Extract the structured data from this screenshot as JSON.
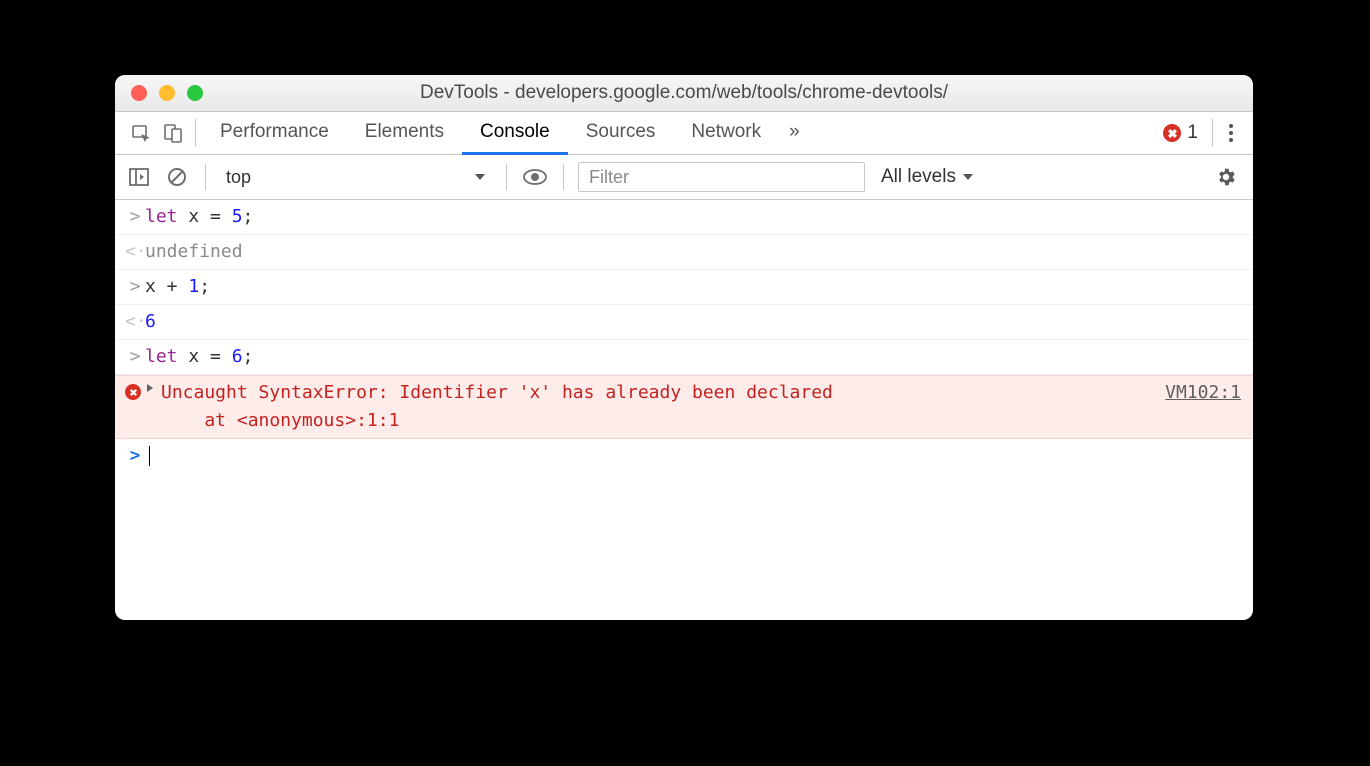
{
  "window": {
    "title": "DevTools - developers.google.com/web/tools/chrome-devtools/"
  },
  "tabs": {
    "items": [
      "Performance",
      "Elements",
      "Console",
      "Sources",
      "Network"
    ],
    "active": "Console",
    "overflow_glyph": "»",
    "error_count": "1"
  },
  "filterbar": {
    "context": "top",
    "filter_placeholder": "Filter",
    "levels_label": "All levels"
  },
  "console": {
    "rows": [
      {
        "kind": "input",
        "marker": ">",
        "tokens": [
          {
            "cls": "kw",
            "t": "let"
          },
          {
            "cls": "txt",
            "t": " x = "
          },
          {
            "cls": "num",
            "t": "5"
          },
          {
            "cls": "txt",
            "t": ";"
          }
        ]
      },
      {
        "kind": "output",
        "marker": "<·",
        "tokens": [
          {
            "cls": "undef",
            "t": "undefined"
          }
        ]
      },
      {
        "kind": "input",
        "marker": ">",
        "tokens": [
          {
            "cls": "txt",
            "t": "x + "
          },
          {
            "cls": "num",
            "t": "1"
          },
          {
            "cls": "txt",
            "t": ";"
          }
        ]
      },
      {
        "kind": "output",
        "marker": "<·",
        "tokens": [
          {
            "cls": "result-num",
            "t": "6"
          }
        ]
      },
      {
        "kind": "input",
        "marker": ">",
        "tokens": [
          {
            "cls": "kw",
            "t": "let"
          },
          {
            "cls": "txt",
            "t": " x = "
          },
          {
            "cls": "num",
            "t": "6"
          },
          {
            "cls": "txt",
            "t": ";"
          }
        ]
      },
      {
        "kind": "error",
        "message": "Uncaught SyntaxError: Identifier 'x' has already been declared\n    at <anonymous>:1:1",
        "source": "VM102:1"
      },
      {
        "kind": "prompt",
        "marker": ">"
      }
    ]
  }
}
